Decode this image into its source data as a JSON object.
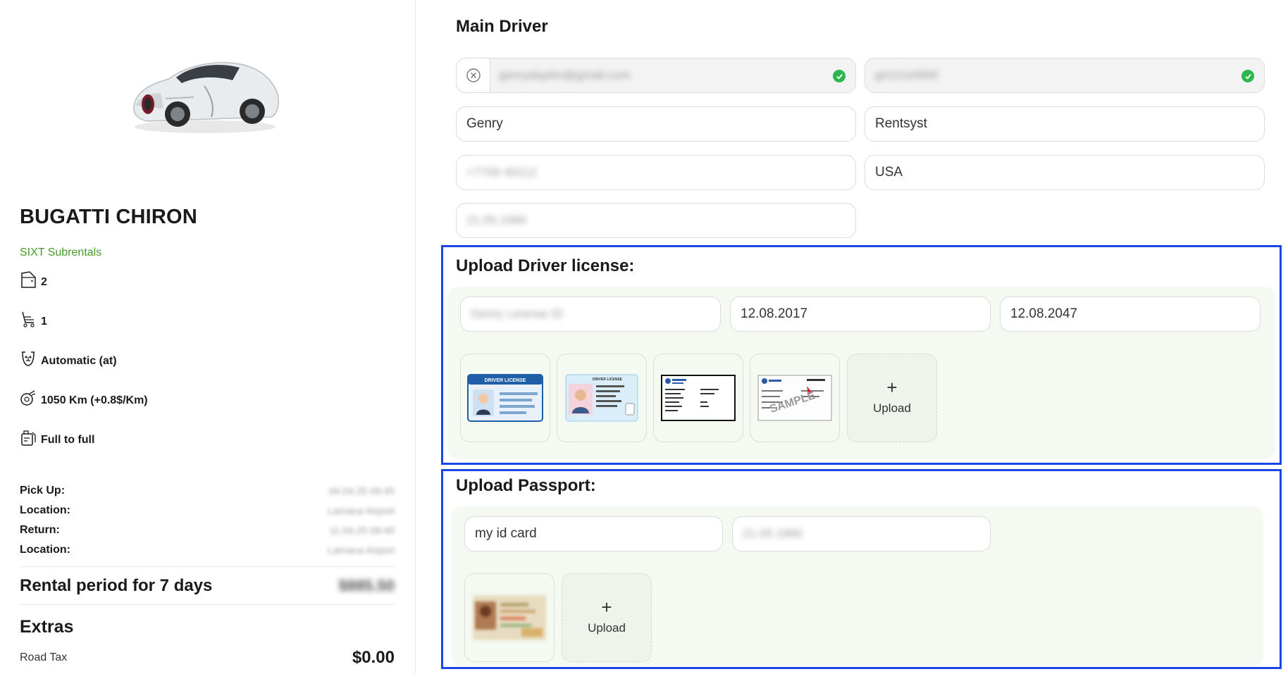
{
  "car": {
    "title": "BUGATTI CHIRON",
    "supplier": "SIXT Subrentals",
    "specs": [
      {
        "icon": "door-icon",
        "value": "2"
      },
      {
        "icon": "seat-icon",
        "value": "1"
      },
      {
        "icon": "gearbox-icon",
        "value": "Automatic (at)"
      },
      {
        "icon": "odometer-icon",
        "value": "1050 Km (+0.8$/Km)"
      },
      {
        "icon": "fuel-icon",
        "value": "Full to full"
      }
    ]
  },
  "booking": {
    "pickup_label": "Pick Up:",
    "pickup_value": "04.04.25 09:45",
    "location_label": "Location:",
    "pickup_location": "Larnaca Airport",
    "return_label": "Return:",
    "return_value": "11.04.25 09:45",
    "return_location_label": "Location:",
    "return_location": "Larnaca Airport"
  },
  "rental": {
    "label": "Rental period for 7 days",
    "value": "$885.50"
  },
  "extras": {
    "title": "Extras",
    "items": [
      {
        "name": "Road Tax",
        "price": "$0.00"
      }
    ]
  },
  "driver": {
    "title": "Main Driver",
    "email": "genrydaylim@gmail.com",
    "password": "gm21o0900",
    "first_name": "Genry",
    "last_name": "Rentsyst",
    "phone": "+7709 40212",
    "country": "USA",
    "birth_date": "21.05.1990"
  },
  "license": {
    "title": "Upload Driver license:",
    "number": "Genry License ID",
    "issue_date": "12.08.2017",
    "expiry_date": "12.08.2047",
    "upload_label": "Upload",
    "thumb_1_text": "DRIVER LICENSE",
    "thumb_2_text": "DRIVER LICENSE",
    "thumb_4_text": "SAMPLE"
  },
  "passport": {
    "title": "Upload Passport:",
    "name": "my id card",
    "date": "21.05.1990",
    "upload_label": "Upload"
  },
  "colors": {
    "accent_border": "#1a47e6",
    "supplier_green": "#4a9a2a",
    "check_green": "#2db84d",
    "upload_area_bg": "#f4f9f1"
  }
}
